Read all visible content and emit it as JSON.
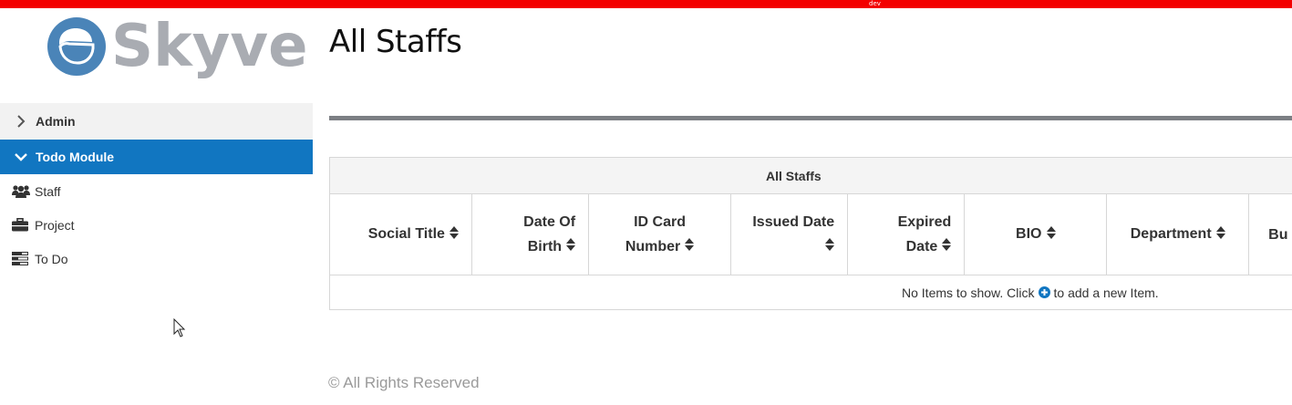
{
  "env": {
    "label": "dev",
    "bar_color": "#f30000"
  },
  "brand": {
    "name": "Skyve",
    "mark_color": "#4a84b8",
    "text_color": "#a9acb2"
  },
  "sidebar": {
    "modules": [
      {
        "label": "Admin",
        "expanded": false
      },
      {
        "label": "Todo Module",
        "expanded": true,
        "active_color": "#1176c1"
      }
    ],
    "items": [
      {
        "label": "Staff",
        "icon": "users-icon"
      },
      {
        "label": "Project",
        "icon": "briefcase-icon"
      },
      {
        "label": "To Do",
        "icon": "list-icon"
      }
    ]
  },
  "page": {
    "title": "All Staffs"
  },
  "grid": {
    "caption": "All Staffs",
    "columns": [
      {
        "line1": "Social Title",
        "line2": ""
      },
      {
        "line1": "Date Of",
        "line2": "Birth"
      },
      {
        "line1": "ID Card",
        "line2": "Number"
      },
      {
        "line1": "Issued Date",
        "line2": ""
      },
      {
        "line1": "Expired",
        "line2": "Date"
      },
      {
        "line1": "BIO",
        "line2": ""
      },
      {
        "line1": "Department",
        "line2": ""
      },
      {
        "line1": "Bu",
        "line2": ""
      }
    ],
    "empty_before": "No Items to show. Click",
    "empty_after": "to add a new Item."
  },
  "footer": {
    "text": "© All Rights Reserved"
  }
}
